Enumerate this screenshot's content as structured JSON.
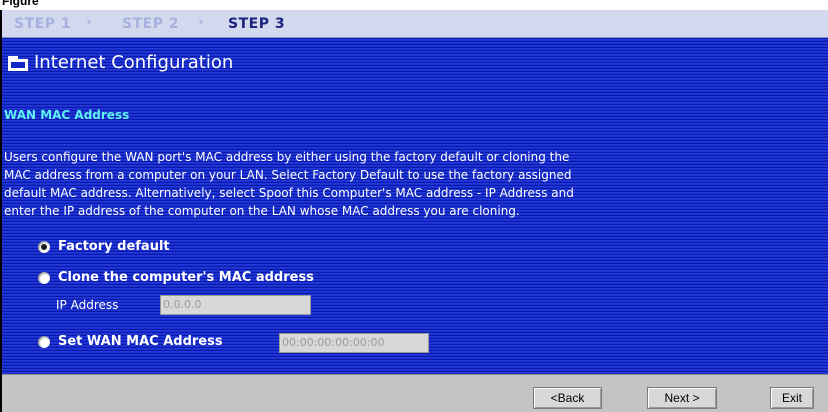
{
  "caption": "Figure",
  "steps": [
    {
      "label": "STEP 1",
      "active": false
    },
    {
      "label": "STEP 2",
      "active": false
    },
    {
      "label": "STEP 3",
      "active": true
    }
  ],
  "step_separator": "›",
  "page_title": "Internet Configuration",
  "section_title": "WAN MAC Address",
  "description_lines": [
    "Users configure the WAN port's MAC address by either using the factory default or cloning the",
    "MAC address from a computer on your LAN. Select Factory Default to use the factory assigned",
    "default MAC address. Alternatively, select Spoof this Computer's MAC address - IP Address and",
    "enter the IP address of the computer on the LAN whose MAC address you are cloning."
  ],
  "options": {
    "factory_default": {
      "label": "Factory default",
      "selected": true
    },
    "clone_computer": {
      "label": "Clone the computer's MAC address",
      "selected": false
    },
    "set_wan_mac": {
      "label": "Set WAN MAC Address",
      "selected": false
    }
  },
  "ip_address": {
    "label": "IP Address",
    "value": "0.0.0.0"
  },
  "wan_mac_value": "00:00:00:00:00:00",
  "buttons": {
    "back": "<Back",
    "next": "Next >",
    "exit": "Exit"
  },
  "icons": {
    "title_icon": "folder-icon"
  },
  "colors": {
    "panel_blue": "#1428c8",
    "section_cyan": "#5ef2f2",
    "step_bar": "#d2d8ee",
    "footer_gray": "#c4c4c4"
  }
}
